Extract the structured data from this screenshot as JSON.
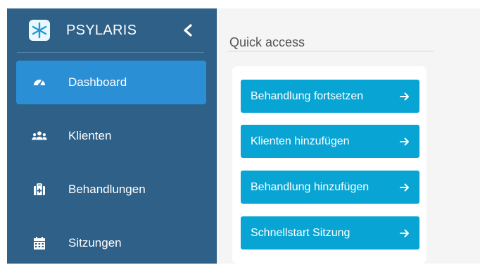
{
  "sidebar": {
    "brand": {
      "name": "PSYLARIS",
      "logo_icon": "snowflake-logo-icon"
    },
    "collapse_icon": "chevron-left-icon",
    "items": [
      {
        "label": "Dashboard",
        "icon": "speedometer-icon",
        "active": true
      },
      {
        "label": "Klienten",
        "icon": "users-icon",
        "active": false
      },
      {
        "label": "Behandlungen",
        "icon": "medical-kit-icon",
        "active": false
      },
      {
        "label": "Sitzungen",
        "icon": "calendar-icon",
        "active": false
      }
    ]
  },
  "main": {
    "quick_access": {
      "title": "Quick access",
      "buttons": [
        {
          "label": "Behandlung fortsetzen",
          "icon": "arrow-right-icon"
        },
        {
          "label": "Klienten hinzufügen",
          "icon": "arrow-right-icon"
        },
        {
          "label": "Behandlung hinzufügen",
          "icon": "arrow-right-icon"
        },
        {
          "label": "Schnellstart Sitzung",
          "icon": "arrow-right-icon"
        }
      ]
    }
  },
  "colors": {
    "sidebar_bg": "#2e6088",
    "active_item": "#2b8fd6",
    "button_bg": "#08a5d4",
    "main_bg": "#f5f5f5"
  }
}
